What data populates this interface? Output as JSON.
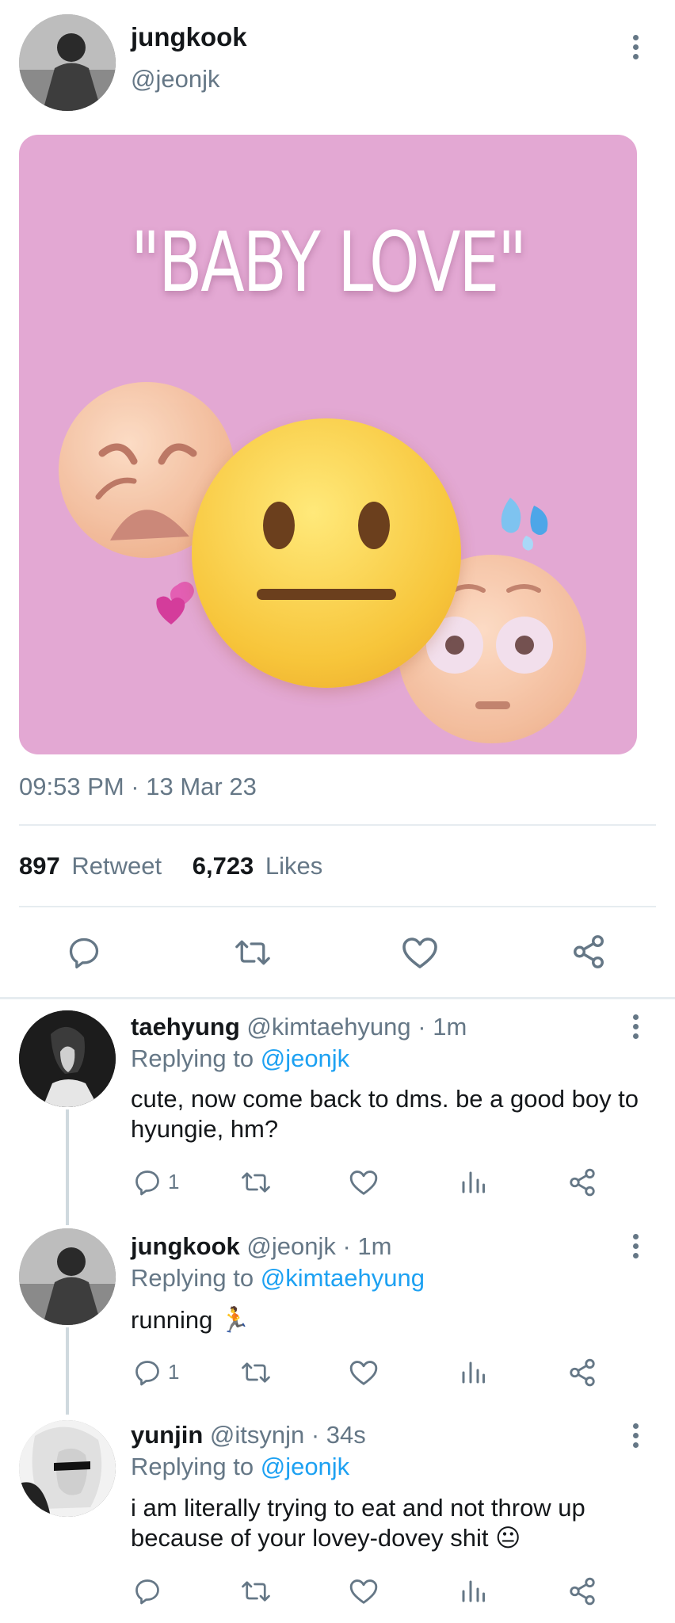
{
  "main_tweet": {
    "display_name": "jungkook",
    "handle": "@jeonjk",
    "image_caption": "\"BABY LOVE\"",
    "timestamp": "09:53 PM · 13 Mar 23",
    "retweet_count": "897",
    "retweet_label": "Retweet",
    "likes_count": "6,723",
    "likes_label": "Likes"
  },
  "replies": [
    {
      "display_name": "taehyung",
      "handle_time": "@kimtaehyung · 1m",
      "replying_prefix": "Replying to",
      "replying_to": "@jeonjk",
      "text": "cute, now come back to dms. be a good boy to hyungie, hm?",
      "reply_count": "1"
    },
    {
      "display_name": "jungkook",
      "handle_time": "@jeonjk · 1m",
      "replying_prefix": "Replying to",
      "replying_to": "@kimtaehyung",
      "text": "running 🏃",
      "reply_count": "1"
    },
    {
      "display_name": "yunjin",
      "handle_time": "@itsynjn · 34s",
      "replying_prefix": "Replying to",
      "replying_to": "@jeonjk",
      "text": "i am literally trying to eat and not throw up because of your lovey-dovey shit 😐",
      "reply_count": ""
    }
  ],
  "icons": {
    "reply": "reply-icon",
    "retweet": "retweet-icon",
    "like": "heart-icon",
    "share": "share-icon",
    "analytics": "analytics-icon",
    "more": "more-vertical-icon"
  },
  "colors": {
    "link": "#1da1f2",
    "muted": "#657786",
    "image_bg": "#e3a8d3"
  }
}
